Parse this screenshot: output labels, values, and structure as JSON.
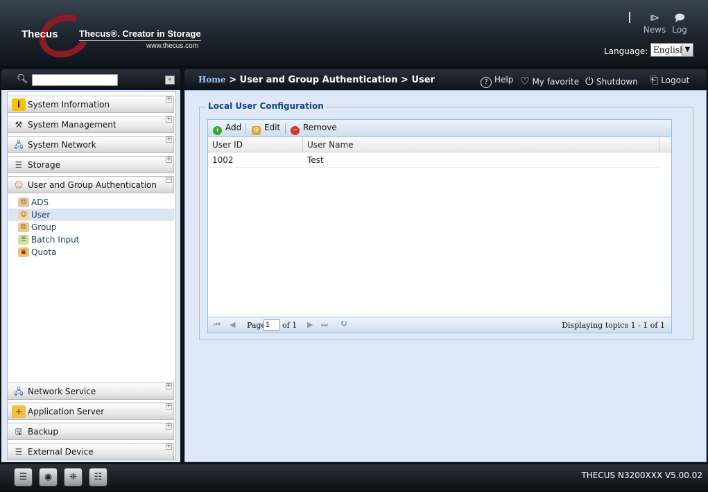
{
  "header": {
    "brand": "Thecus",
    "tagline": "Thecus®. Creator in Storage",
    "url": "www.thecus.com",
    "news_label": "News",
    "log_label": "Log",
    "language_label": "Language:",
    "language_value": "English"
  },
  "sidebar": {
    "search_value": "",
    "collapse_label": "«",
    "sections_top": [
      {
        "label": "System Information",
        "toggle": "+",
        "icon": "info-icon"
      },
      {
        "label": "System Management",
        "toggle": "+",
        "icon": "tools-icon"
      },
      {
        "label": "System Network",
        "toggle": "+",
        "icon": "network-icon"
      },
      {
        "label": "Storage",
        "toggle": "+",
        "icon": "storage-icon"
      },
      {
        "label": "User and Group Authentication",
        "toggle": "−",
        "icon": "users-icon"
      }
    ],
    "tree": [
      {
        "label": "ADS",
        "icon": "ads-icon"
      },
      {
        "label": "User",
        "icon": "user-icon",
        "selected": true
      },
      {
        "label": "Group",
        "icon": "group-icon"
      },
      {
        "label": "Batch Input",
        "icon": "batch-input-icon"
      },
      {
        "label": "Quota",
        "icon": "quota-icon"
      }
    ],
    "sections_bottom": [
      {
        "label": "Network Service",
        "toggle": "+",
        "icon": "network-service-icon"
      },
      {
        "label": "Application Server",
        "toggle": "+",
        "icon": "application-server-icon"
      },
      {
        "label": "Backup",
        "toggle": "+",
        "icon": "backup-icon"
      },
      {
        "label": "External Device",
        "toggle": "+",
        "icon": "external-device-icon"
      }
    ]
  },
  "topbar": {
    "breadcrumb_home": "Home",
    "breadcrumb_rest": " > User and Group Authentication > User",
    "help": "Help",
    "favorite": "My favorite",
    "shutdown": "Shutdown",
    "logout": "Logout"
  },
  "main": {
    "legend": "Local User Configuration",
    "toolbar": {
      "add": "Add",
      "edit": "Edit",
      "remove": "Remove"
    },
    "columns": [
      "User ID",
      "User Name"
    ],
    "rows": [
      {
        "id": "1002",
        "name": "Test"
      }
    ],
    "pager": {
      "page_label": "Page",
      "page_value": "1",
      "of_label": "of 1",
      "display_text": "Displaying topics 1 - 1 of 1"
    }
  },
  "footer": {
    "version": "THECUS N3200XXX V5.00.02"
  },
  "colors": {
    "accent": "#15428b",
    "panel_bg": "#dfe8f6",
    "border": "#99bbe8",
    "selected_row": "#dbe6f5",
    "logo_red": "#8c1c24"
  }
}
